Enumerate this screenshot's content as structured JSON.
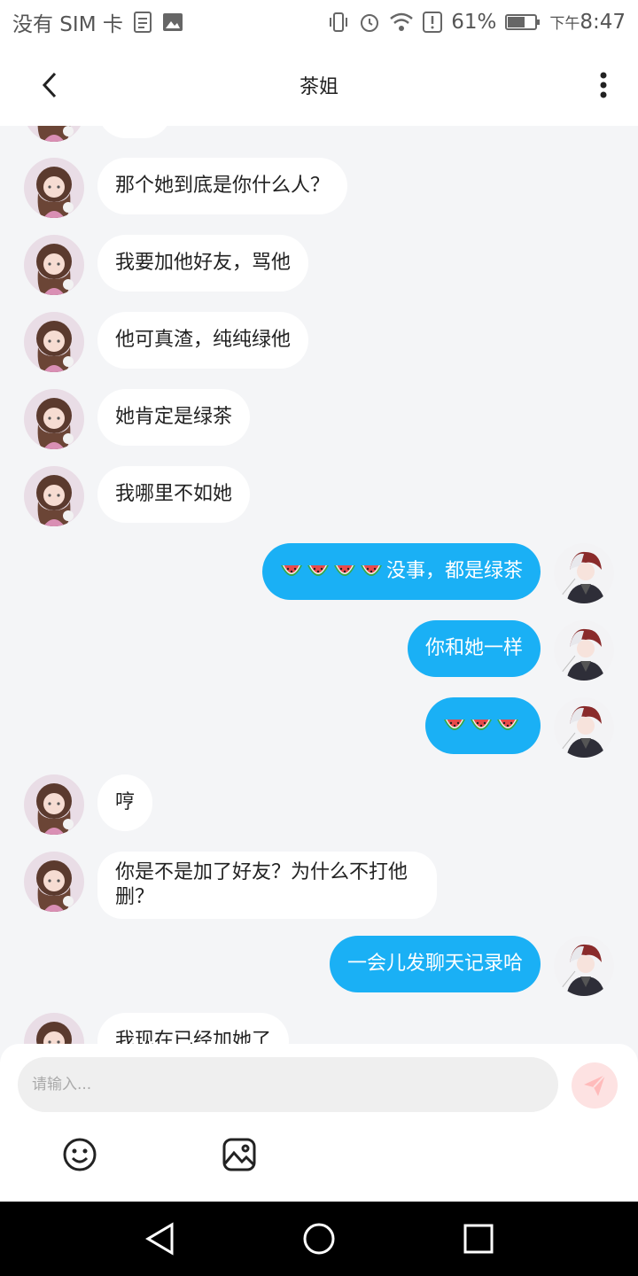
{
  "status_bar": {
    "carrier": "没有 SIM 卡",
    "battery": "61%",
    "time_prefix": "下午",
    "time": "8:47"
  },
  "header": {
    "title": "茶姐",
    "back_icon": "chevron-left-icon",
    "more_icon": "more-vertical-icon"
  },
  "messages": [
    {
      "side": "left",
      "text": "那个她到底是你什么人？"
    },
    {
      "side": "left",
      "text": "我要加他好友，骂他"
    },
    {
      "side": "left",
      "text": "他可真渣，纯纯绿他"
    },
    {
      "side": "left",
      "text": "她肯定是绿茶"
    },
    {
      "side": "left",
      "text": "我哪里不如她"
    },
    {
      "side": "right",
      "text": "没事，都是绿茶",
      "emoji": "watermelon",
      "emoji_count": 4
    },
    {
      "side": "right",
      "text": "你和她一样"
    },
    {
      "side": "right",
      "text": "",
      "emoji": "watermelon",
      "emoji_count": 3
    },
    {
      "side": "left",
      "text": "哼"
    },
    {
      "side": "left",
      "text": "你是不是加了好友？为什么不打他删？"
    },
    {
      "side": "right",
      "text": "一会儿发聊天记录哈"
    },
    {
      "side": "left",
      "text": "我现在已经加她了"
    }
  ],
  "input": {
    "placeholder": "请输入..."
  },
  "toolbar": {
    "emoji_icon": "smiley-icon",
    "image_icon": "image-icon",
    "send_icon": "send-icon"
  },
  "colors": {
    "outgoing_bubble": "#1ab0f5",
    "incoming_bubble": "#ffffff",
    "background": "#f4f5f7",
    "send_button": "#fde2e2"
  }
}
